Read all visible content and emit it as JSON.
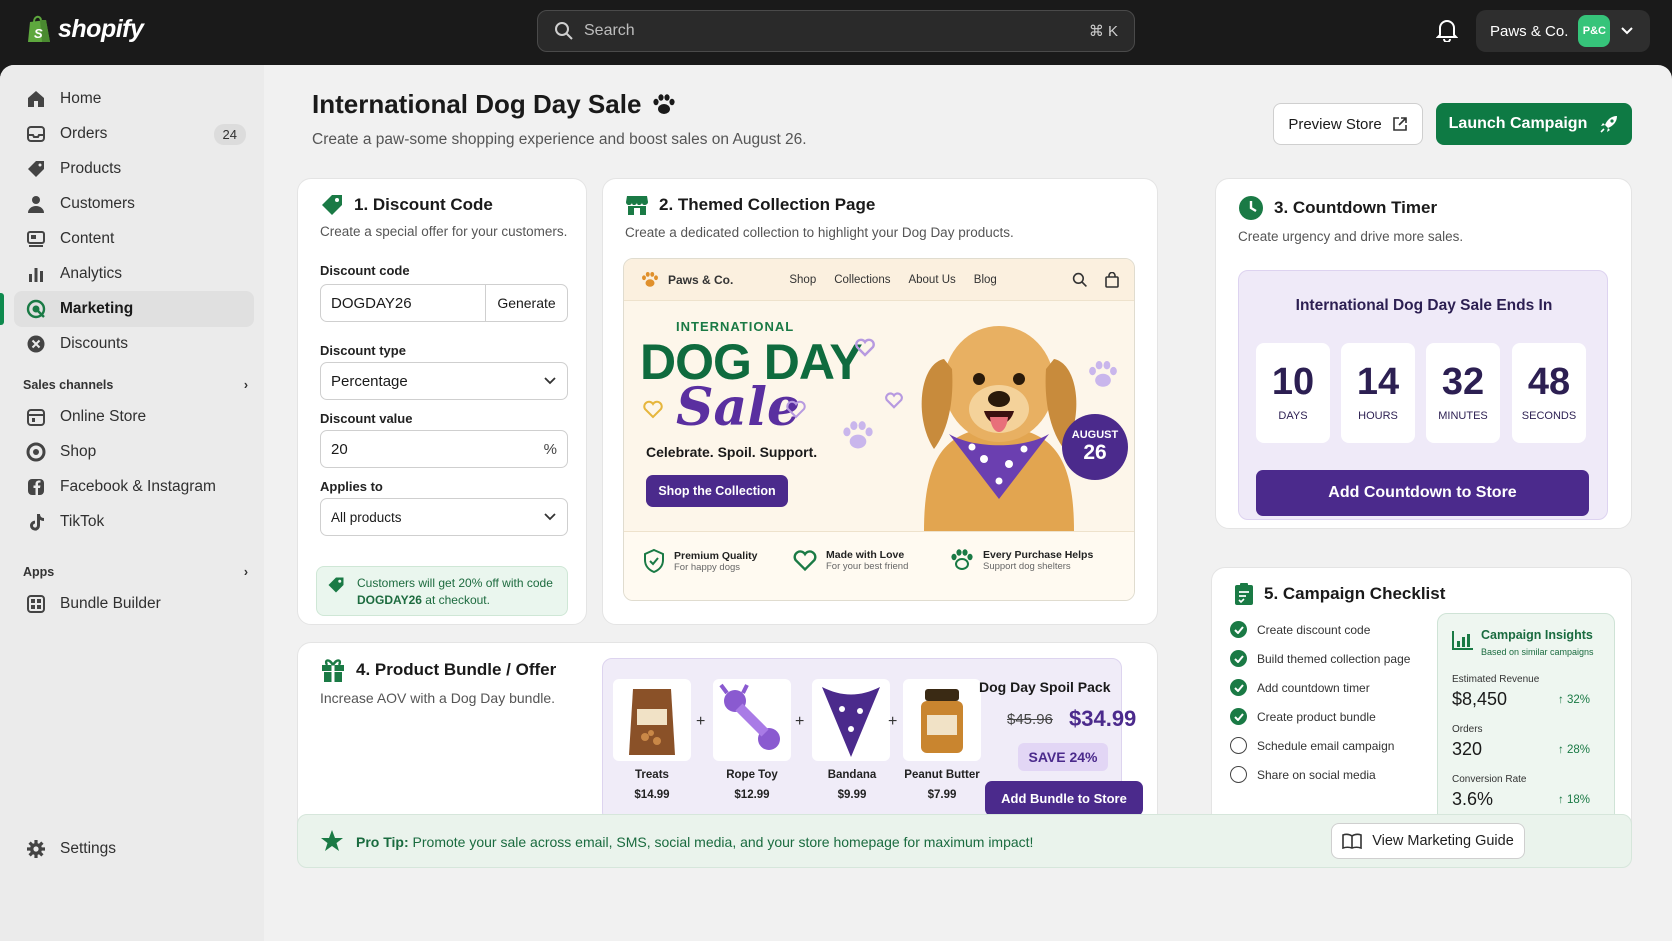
{
  "topbar": {
    "brand": "shopify",
    "search_placeholder": "Search",
    "search_shortcut": "⌘ K",
    "store_name": "Paws & Co.",
    "store_initials": "P&C"
  },
  "sidebar": {
    "items": [
      {
        "label": "Home"
      },
      {
        "label": "Orders",
        "badge": "24"
      },
      {
        "label": "Products"
      },
      {
        "label": "Customers"
      },
      {
        "label": "Content"
      },
      {
        "label": "Analytics"
      },
      {
        "label": "Marketing"
      },
      {
        "label": "Discounts"
      }
    ],
    "sales_channels_label": "Sales channels",
    "channels": [
      {
        "label": "Online Store"
      },
      {
        "label": "Shop"
      },
      {
        "label": "Facebook & Instagram"
      },
      {
        "label": "TikTok"
      }
    ],
    "apps_label": "Apps",
    "apps": [
      {
        "label": "Bundle Builder"
      }
    ],
    "settings_label": "Settings"
  },
  "page": {
    "title": "International Dog Day Sale",
    "subtitle": "Create a paw-some shopping experience and boost sales on August 26.",
    "preview_label": "Preview Store",
    "launch_label": "Launch Campaign"
  },
  "discount": {
    "heading": "1. Discount Code",
    "sub": "Create a special offer for your customers.",
    "code_label": "Discount code",
    "code_value": "DOGDAY26",
    "generate_label": "Generate",
    "type_label": "Discount type",
    "type_value": "Percentage",
    "value_label": "Discount value",
    "value_value": "20",
    "value_unit": "%",
    "applies_label": "Applies to",
    "applies_value": "All products",
    "note_prefix": "Customers will get 20% off with code",
    "note_code": "DOGDAY26",
    "note_suffix": "at checkout."
  },
  "collection": {
    "heading": "2. Themed Collection Page",
    "sub": "Create a dedicated collection to highlight your Dog Day products.",
    "store_name": "Paws & Co.",
    "nav": [
      "Shop",
      "Collections",
      "About Us",
      "Blog"
    ],
    "kicker": "INTERNATIONAL",
    "headline": "DOG DAY",
    "script": "Sale",
    "tagline": "Celebrate. Spoil. Support.",
    "cta": "Shop the Collection",
    "badge_month": "AUGUST",
    "badge_day": "26",
    "features": [
      {
        "title": "Premium Quality",
        "sub": "For happy dogs"
      },
      {
        "title": "Made with Love",
        "sub": "For your best friend"
      },
      {
        "title": "Every Purchase Helps",
        "sub": "Support dog shelters"
      }
    ]
  },
  "countdown": {
    "heading": "3. Countdown Timer",
    "sub": "Create urgency and drive more sales.",
    "box_title": "International Dog Day Sale Ends In",
    "units": [
      {
        "value": "10",
        "label": "DAYS"
      },
      {
        "value": "14",
        "label": "HOURS"
      },
      {
        "value": "32",
        "label": "MINUTES"
      },
      {
        "value": "48",
        "label": "SECONDS"
      }
    ],
    "button": "Add Countdown to Store"
  },
  "bundle": {
    "heading": "4. Product Bundle / Offer",
    "sub": "Increase AOV with a Dog Day bundle.",
    "items": [
      {
        "name": "Treats",
        "price": "$14.99"
      },
      {
        "name": "Rope Toy",
        "price": "$12.99"
      },
      {
        "name": "Bandana",
        "price": "$9.99"
      },
      {
        "name": "Peanut Butter",
        "price": "$7.99"
      }
    ],
    "pack_name": "Dog Day Spoil Pack",
    "old_price": "$45.96",
    "new_price": "$34.99",
    "save": "SAVE 24%",
    "button": "Add Bundle to Store"
  },
  "checklist": {
    "heading": "5. Campaign Checklist",
    "items": [
      {
        "label": "Create discount code",
        "done": true
      },
      {
        "label": "Build themed collection page",
        "done": true
      },
      {
        "label": "Add countdown timer",
        "done": true
      },
      {
        "label": "Create product bundle",
        "done": true
      },
      {
        "label": "Schedule email campaign",
        "done": false
      },
      {
        "label": "Share on social media",
        "done": false
      }
    ],
    "insights_title": "Campaign Insights",
    "insights_sub": "Based on similar campaigns",
    "metrics": [
      {
        "label": "Estimated Revenue",
        "value": "$8,450",
        "delta": "32%"
      },
      {
        "label": "Orders",
        "value": "320",
        "delta": "28%"
      },
      {
        "label": "Conversion Rate",
        "value": "3.6%",
        "delta": "18%"
      }
    ]
  },
  "protip": {
    "label": "Pro Tip:",
    "text": "Promote your sale across email, SMS, social media, and your store homepage for maximum impact!",
    "button": "View Marketing Guide"
  },
  "colors": {
    "accent_green": "#0e7a44",
    "accent_purple": "#4b2a8c"
  }
}
